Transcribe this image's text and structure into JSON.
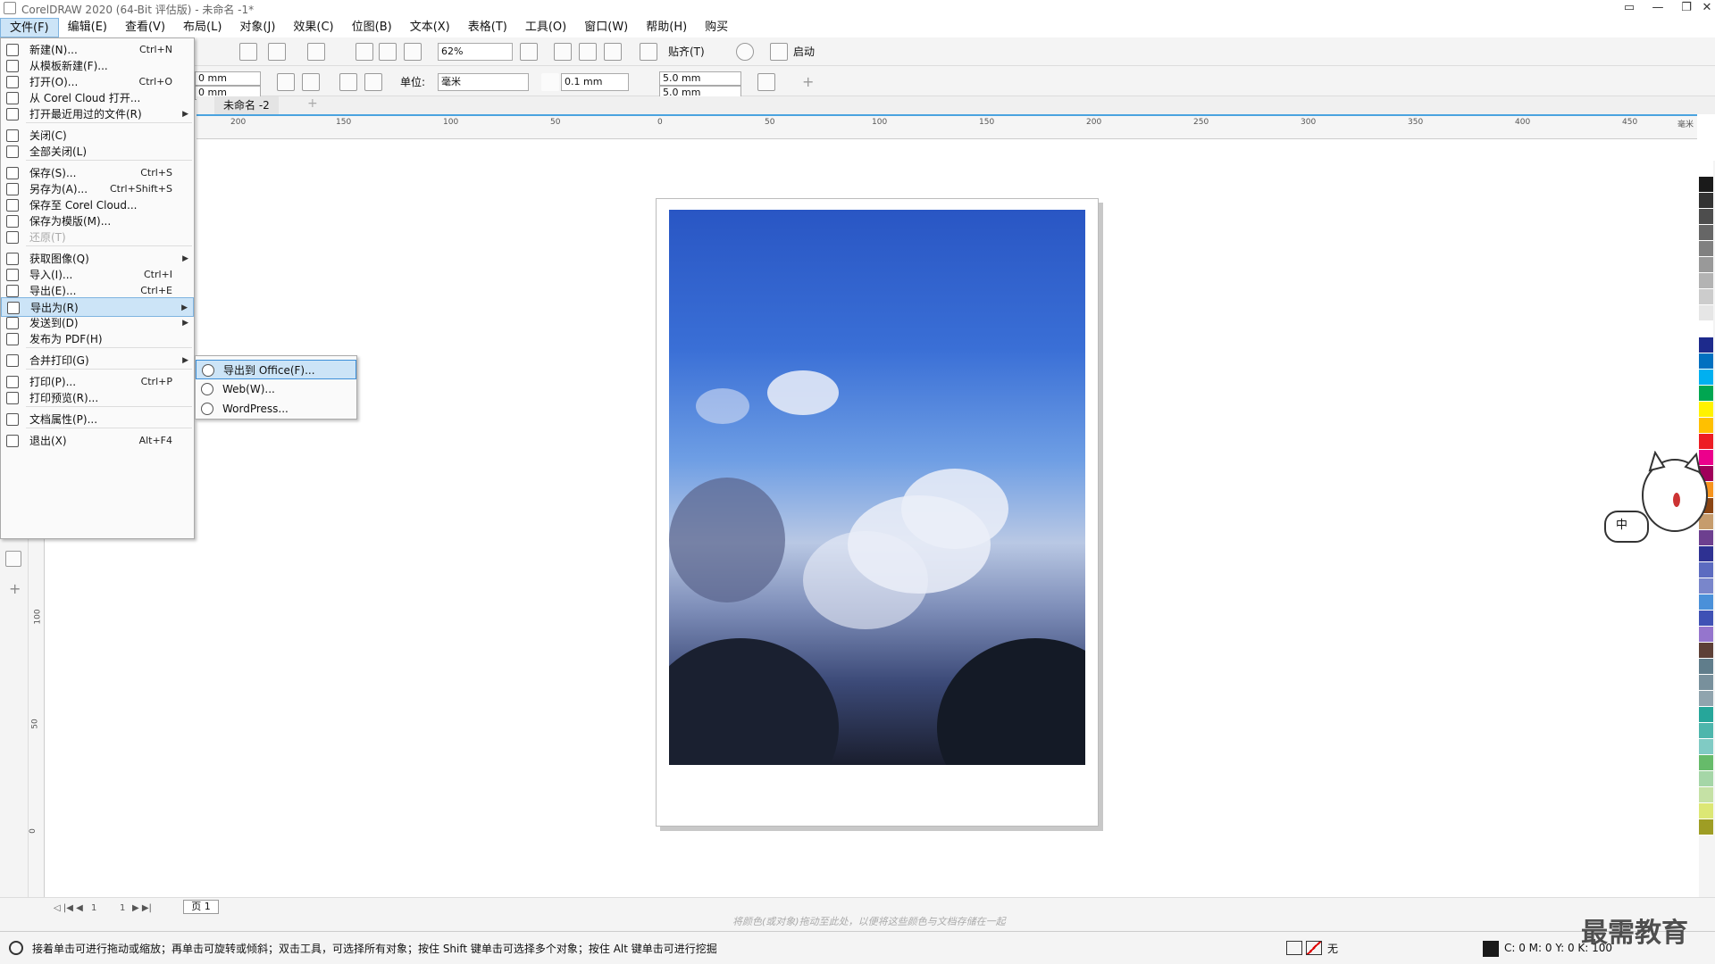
{
  "window": {
    "title": "CorelDRAW 2020 (64-Bit 评估版) - 未命名 -1*"
  },
  "menubar": {
    "items": [
      "文件(F)",
      "编辑(E)",
      "查看(V)",
      "布局(L)",
      "对象(J)",
      "效果(C)",
      "位图(B)",
      "文本(X)",
      "表格(T)",
      "工具(O)",
      "窗口(W)",
      "帮助(H)",
      "购买"
    ]
  },
  "toolbar": {
    "zoom": "62%",
    "snap_label": "贴齐(T)",
    "launch_label": "启动",
    "width1": "0 mm",
    "width2": "0 mm",
    "unit_label": "单位:",
    "unit_value": "毫米",
    "nudge": "0.1 mm",
    "dup_x": "5.0 mm",
    "dup_y": "5.0 mm"
  },
  "document_tab": "未命名 -2",
  "hruler_ticks": [
    "200",
    "150",
    "100",
    "50",
    "0",
    "50",
    "100",
    "150",
    "200",
    "250",
    "300",
    "350",
    "400",
    "450",
    "毫米"
  ],
  "vruler_ticks": [
    "100",
    "50",
    "0"
  ],
  "file_menu": [
    {
      "label": "新建(N)...",
      "shortcut": "Ctrl+N"
    },
    {
      "label": "从模板新建(F)...",
      "shortcut": ""
    },
    {
      "label": "打开(O)...",
      "shortcut": "Ctrl+O"
    },
    {
      "label": "从 Corel Cloud 打开...",
      "shortcut": ""
    },
    {
      "label": "打开最近用过的文件(R)",
      "shortcut": "",
      "arrow": true
    },
    {
      "label": "关闭(C)",
      "shortcut": ""
    },
    {
      "label": "全部关闭(L)",
      "shortcut": ""
    },
    {
      "label": "保存(S)...",
      "shortcut": "Ctrl+S"
    },
    {
      "label": "另存为(A)...",
      "shortcut": "Ctrl+Shift+S"
    },
    {
      "label": "保存至 Corel Cloud...",
      "shortcut": ""
    },
    {
      "label": "保存为模版(M)...",
      "shortcut": ""
    },
    {
      "label": "还原(T)",
      "shortcut": "",
      "disabled": true
    },
    {
      "label": "获取图像(Q)",
      "shortcut": "",
      "arrow": true
    },
    {
      "label": "导入(I)...",
      "shortcut": "Ctrl+I"
    },
    {
      "label": "导出(E)...",
      "shortcut": "Ctrl+E"
    },
    {
      "label": "导出为(R)",
      "shortcut": "",
      "arrow": true,
      "highlighted": true
    },
    {
      "label": "发送到(D)",
      "shortcut": "",
      "arrow": true
    },
    {
      "label": "发布为 PDF(H)",
      "shortcut": ""
    },
    {
      "label": "合并打印(G)",
      "shortcut": "",
      "arrow": true
    },
    {
      "label": "打印(P)...",
      "shortcut": "Ctrl+P"
    },
    {
      "label": "打印预览(R)...",
      "shortcut": ""
    },
    {
      "label": "文档属性(P)...",
      "shortcut": ""
    },
    {
      "label": "退出(X)",
      "shortcut": "Alt+F4"
    }
  ],
  "export_submenu": [
    "导出到 Office(F)...",
    "Web(W)...",
    "WordPress..."
  ],
  "page_nav": {
    "current": "1",
    "of": "1",
    "page_tab": "页 1"
  },
  "palette_hint": "将颜色(或对象)拖动至此处，以便将这些颜色与文档存储在一起",
  "status": {
    "message": "接着单击可进行拖动或缩放；再单击可旋转或倾斜；双击工具，可选择所有对象；按住 Shift 键单击可选择多个对象；按住 Alt 键单击可进行挖掘",
    "fill_label": "无",
    "cmyk": "C: 0 M: 0 Y: 0 K: 100"
  },
  "watermark": "最需教育",
  "ime": "中",
  "palette_colors": [
    "#ffffff",
    "#1a1a1a",
    "#333333",
    "#4d4d4d",
    "#666666",
    "#808080",
    "#999999",
    "#b3b3b3",
    "#cccccc",
    "#e6e6e6",
    "#ffffff",
    "#1d2a8c",
    "#0070c0",
    "#00b0f0",
    "#00a651",
    "#fff200",
    "#ffc000",
    "#ed1c24",
    "#ec008c",
    "#a0005a",
    "#f7941d",
    "#8b4513",
    "#c69c6d",
    "#6d3f8f",
    "#2e3192",
    "#5c6bc0",
    "#7986cb",
    "#4a90d9",
    "#3f51b5",
    "#9575cd",
    "#5d4037",
    "#607d8b",
    "#78909c",
    "#90a4ae",
    "#26a69a",
    "#4db6ac",
    "#80cbc4",
    "#66bb6a",
    "#a5d6a7",
    "#c5e1a5",
    "#dce775",
    "#9e9d24"
  ]
}
